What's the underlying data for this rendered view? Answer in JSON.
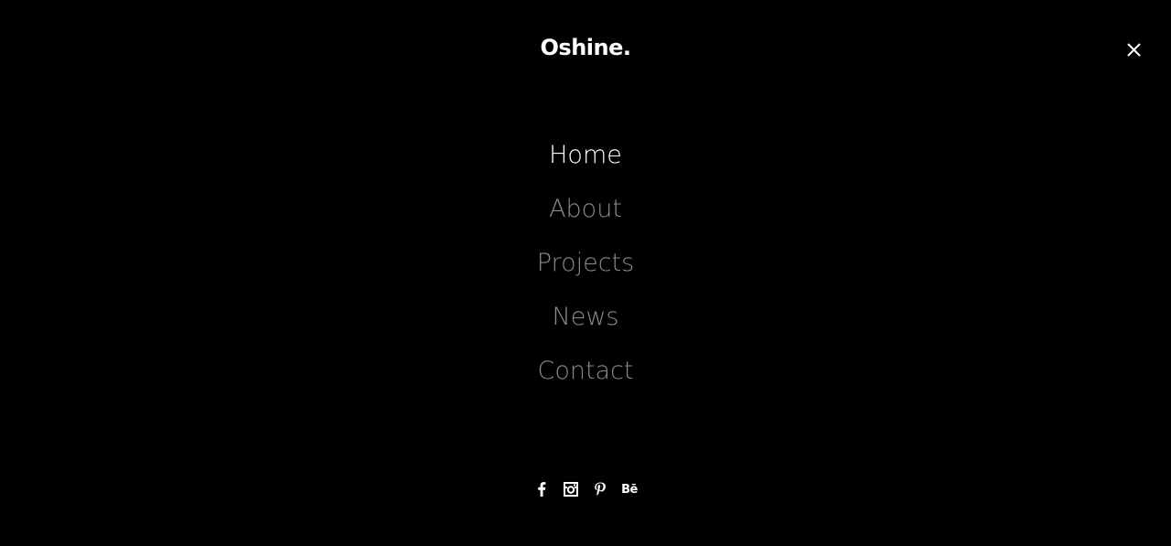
{
  "header": {
    "logo": "Oshine.",
    "close_icon": "close-icon"
  },
  "menu": {
    "items": [
      {
        "label": "Home",
        "active": true
      },
      {
        "label": "About",
        "active": false
      },
      {
        "label": "Projects",
        "active": false
      },
      {
        "label": "News",
        "active": false
      },
      {
        "label": "Contact",
        "active": false
      }
    ]
  },
  "social": {
    "icons": [
      "facebook-icon",
      "instagram-icon",
      "pinterest-icon",
      "behance-icon"
    ],
    "behance_label": "Bē"
  },
  "colors": {
    "background": "#000000",
    "active_item": "#ffffff",
    "inactive_item": "#8a8a8a"
  }
}
